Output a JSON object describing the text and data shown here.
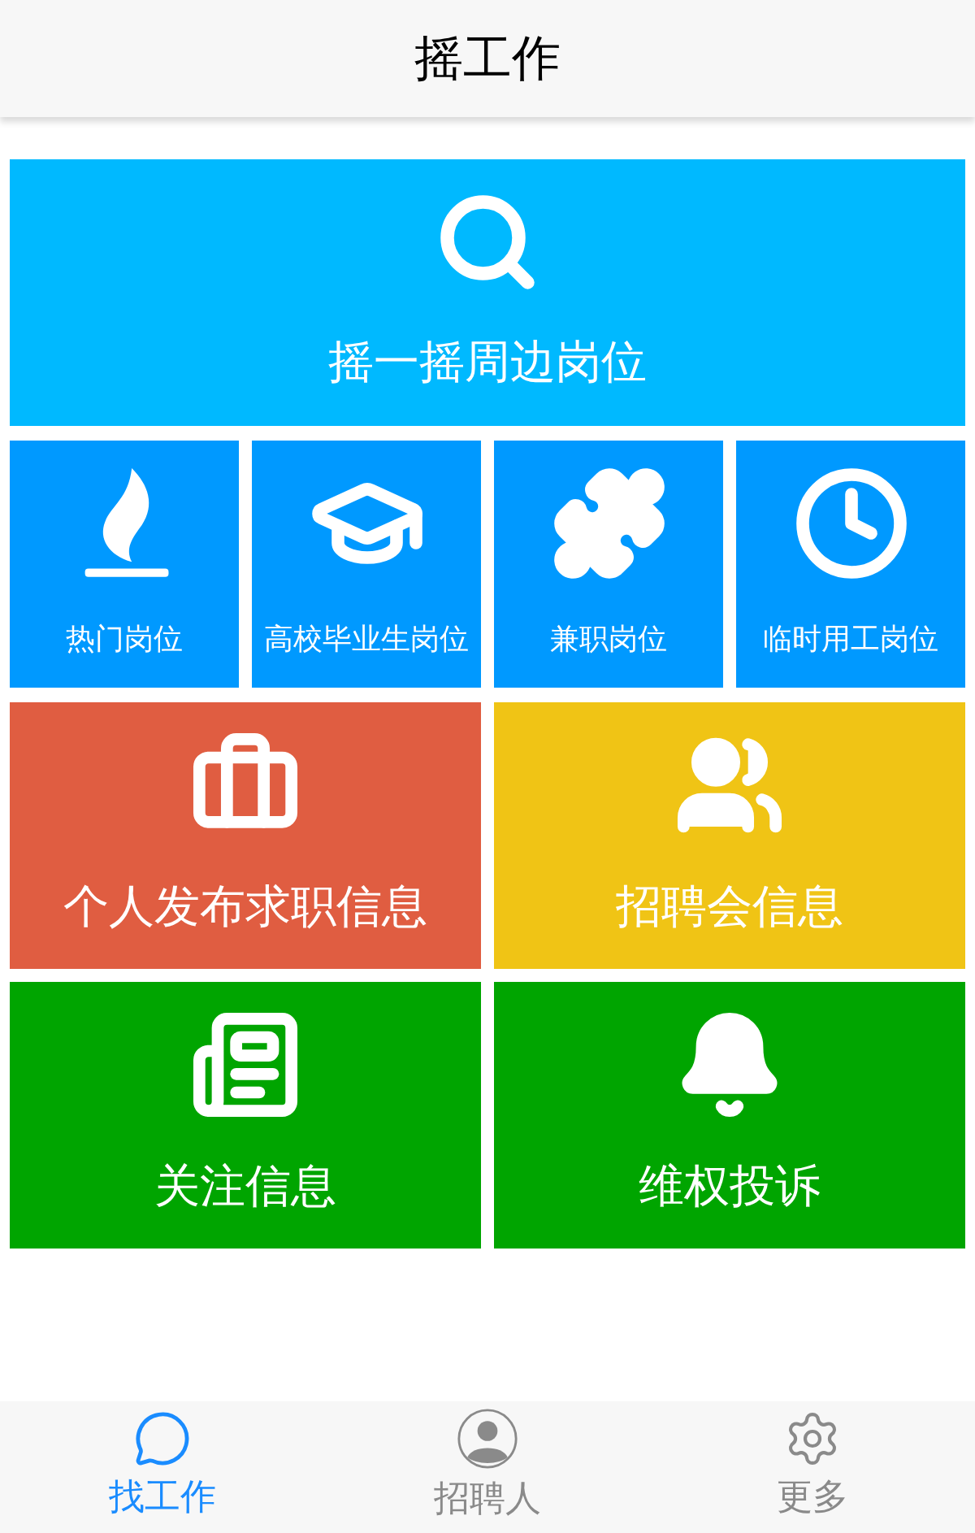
{
  "header": {
    "title": "摇工作"
  },
  "hero": {
    "label": "摇一摇周边岗位",
    "kind": "search"
  },
  "categories": [
    {
      "label": "热门岗位",
      "kind": "flame"
    },
    {
      "label": "高校毕业生岗位",
      "kind": "cap"
    },
    {
      "label": "兼职岗位",
      "kind": "puzzle"
    },
    {
      "label": "临时用工岗位",
      "kind": "clock"
    }
  ],
  "tiles": [
    {
      "label": "个人发布求职信息",
      "kind": "briefcase",
      "color": "#e05d41"
    },
    {
      "label": "招聘会信息",
      "kind": "people",
      "color": "#f0c415"
    },
    {
      "label": "关注信息",
      "kind": "newspaper",
      "color": "#00a500"
    },
    {
      "label": "维权投诉",
      "kind": "bell",
      "color": "#00a500"
    }
  ],
  "tab_bar": [
    {
      "label": "找工作",
      "kind": "chat",
      "selected": true
    },
    {
      "label": "招聘人",
      "kind": "person",
      "selected": false
    },
    {
      "label": "更多",
      "kind": "gear",
      "selected": false
    }
  ]
}
